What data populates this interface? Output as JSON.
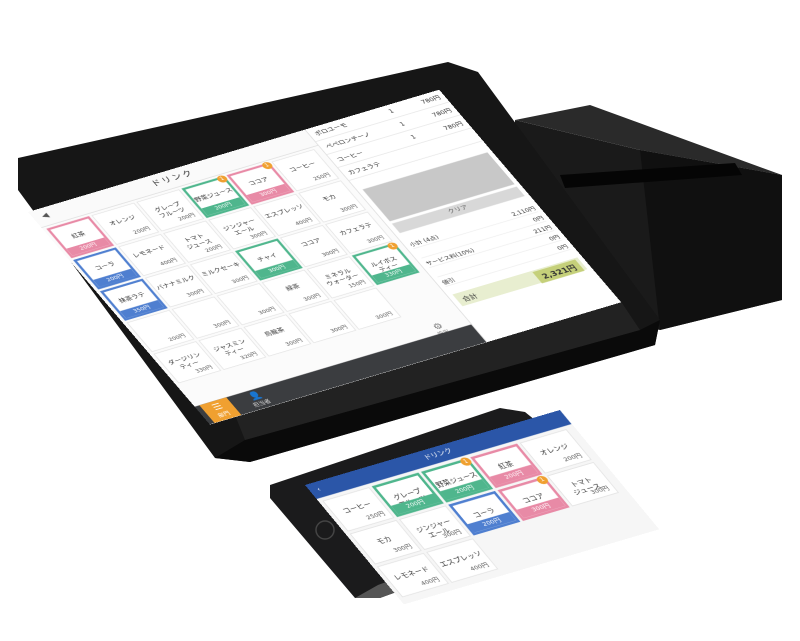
{
  "tablet": {
    "title": "ドリンク",
    "back_icon": "back-arrow-icon",
    "tiles": [
      {
        "name": "紅茶",
        "price": "200円",
        "state": "pink"
      },
      {
        "name": "オレンジ",
        "price": "200円",
        "state": ""
      },
      {
        "name": "グレープ\nフルーツ",
        "price": "200円",
        "state": ""
      },
      {
        "name": "野菜ジュース",
        "price": "200円",
        "state": "green",
        "badge": "1"
      },
      {
        "name": "ココア",
        "price": "300円",
        "state": "pink",
        "badge": "1"
      },
      {
        "name": "コーヒー",
        "price": "250円",
        "state": ""
      },
      {
        "name": "コーラ",
        "price": "200円",
        "state": "blue"
      },
      {
        "name": "レモネード",
        "price": "400円",
        "state": ""
      },
      {
        "name": "トマト\nジュース",
        "price": "200円",
        "state": ""
      },
      {
        "name": "ジンジャー\nエール",
        "price": "300円",
        "state": ""
      },
      {
        "name": "エスプレッソ",
        "price": "400円",
        "state": ""
      },
      {
        "name": "モカ",
        "price": "300円",
        "state": ""
      },
      {
        "name": "抹茶ラテ",
        "price": "350円",
        "state": "blue"
      },
      {
        "name": "バナナミルク",
        "price": "300円",
        "state": ""
      },
      {
        "name": "ミルクセーキ",
        "price": "300円",
        "state": ""
      },
      {
        "name": "チャイ",
        "price": "300円",
        "state": "green"
      },
      {
        "name": "ココア",
        "price": "300円",
        "state": ""
      },
      {
        "name": "カフェラテ",
        "price": "300円",
        "state": ""
      },
      {
        "name": "",
        "price": "200円",
        "state": ""
      },
      {
        "name": "",
        "price": "300円",
        "state": ""
      },
      {
        "name": "",
        "price": "300円",
        "state": ""
      },
      {
        "name": "緑茶",
        "price": "300円",
        "state": ""
      },
      {
        "name": "ミネラル\nウォーター",
        "price": "150円",
        "state": ""
      },
      {
        "name": "ルイボス\nティー",
        "price": "330円",
        "state": "green",
        "badge": "1"
      },
      {
        "name": "ダージリン\nティー",
        "price": "330円",
        "state": ""
      },
      {
        "name": "ジャスミン\nティー",
        "price": "320円",
        "state": ""
      },
      {
        "name": "烏龍茶",
        "price": "300円",
        "state": ""
      },
      {
        "name": "",
        "price": "300円",
        "state": ""
      },
      {
        "name": "",
        "price": "300円",
        "state": ""
      }
    ],
    "settings_label": "設定",
    "menu_label": "部門",
    "user_label": "担当者",
    "order": [
      {
        "name": "ポロユーモ",
        "qty": "1",
        "price": "780円"
      },
      {
        "name": "ペペロンチーノ",
        "qty": "1",
        "price": "780円"
      },
      {
        "name": "コーヒー",
        "qty": "1",
        "price": "780円"
      },
      {
        "name": "カフェラテ",
        "qty": "",
        "price": ""
      }
    ],
    "clear_label": "クリア",
    "summary": [
      {
        "label": "小計 (4点)",
        "value": "2,110円"
      },
      {
        "label": "",
        "value": "0円"
      },
      {
        "label": "サービス料(10%)",
        "value": "211円"
      },
      {
        "label": "",
        "value": "0円"
      },
      {
        "label": "値引",
        "value": "0円"
      }
    ],
    "total_label": "合計",
    "total_value": "2,321円"
  },
  "phone": {
    "title": "ドリンク",
    "tiles": [
      {
        "name": "コーヒー",
        "price": "250円",
        "state": ""
      },
      {
        "name": "グレープ\nフルーツ",
        "price": "200円",
        "state": "green"
      },
      {
        "name": "野菜ジュース",
        "price": "200円",
        "state": "green",
        "badge": "1"
      },
      {
        "name": "紅茶",
        "price": "200円",
        "state": "pink"
      },
      {
        "name": "オレンジ",
        "price": "200円",
        "state": ""
      },
      {
        "name": "モカ",
        "price": "300円",
        "state": ""
      },
      {
        "name": "ジンジャー\nエール",
        "price": "300円",
        "state": ""
      },
      {
        "name": "コーラ",
        "price": "200円",
        "state": "blue"
      },
      {
        "name": "ココア",
        "price": "300円",
        "state": "pink",
        "badge": "1"
      },
      {
        "name": "トマト\nジュース",
        "price": "300円",
        "state": ""
      },
      {
        "name": "レモネード",
        "price": "400円",
        "state": ""
      },
      {
        "name": "エスプレッソ",
        "price": "400円",
        "state": ""
      }
    ]
  }
}
